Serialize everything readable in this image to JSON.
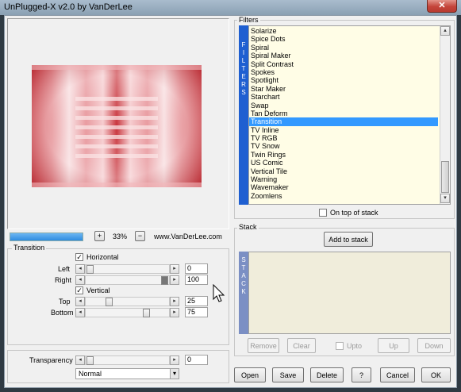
{
  "window": {
    "title": "UnPlugged-X v2.0 by VanDerLee",
    "close_glyph": "✕"
  },
  "zoom": {
    "plus": "+",
    "minus": "−",
    "value": "33%",
    "website": "www.VanDerLee.com",
    "progress": 1.0
  },
  "transition": {
    "group_label": "Transition",
    "horizontal_label": "Horizontal",
    "horizontal_checked": true,
    "vertical_label": "Vertical",
    "vertical_checked": true,
    "left": {
      "label": "Left",
      "value": "0"
    },
    "right": {
      "label": "Right",
      "value": "100"
    },
    "top": {
      "label": "Top",
      "value": "25"
    },
    "bottom": {
      "label": "Bottom",
      "value": "75"
    }
  },
  "transparency": {
    "label": "Transparency",
    "value": "0",
    "blend_mode": "Normal"
  },
  "filters": {
    "group_label": "Filters",
    "side_label": "FILTERS",
    "items": [
      "Solarize",
      "Spice Dots",
      "Spiral",
      "Spiral Maker",
      "Split Contrast",
      "Spokes",
      "Spotlight",
      "Star Maker",
      "Starchart",
      "Swap",
      "Tan Deform",
      "Transition",
      "TV Inline",
      "TV RGB",
      "TV Snow",
      "Twin Rings",
      "US Comic",
      "Vertical Tile",
      "Warning",
      "Wavemaker",
      "Zoomlens"
    ],
    "selected": "Transition",
    "on_top_label": "On top of stack"
  },
  "stack": {
    "group_label": "Stack",
    "side_label": "STACK",
    "add_label": "Add to stack",
    "remove_label": "Remove",
    "clear_label": "Clear",
    "upto_label": "Upto",
    "up_label": "Up",
    "down_label": "Down"
  },
  "footer": {
    "open": "Open",
    "save": "Save",
    "delete": "Delete",
    "help": "?",
    "cancel": "Cancel",
    "ok": "OK"
  },
  "icons": {
    "check": "✓",
    "left_arrow": "◂",
    "right_arrow": "▸",
    "up_arrow": "▴",
    "down_arrow": "▾"
  },
  "colors": {
    "accent": "#3399ff",
    "side_bar": "#1f5fd1",
    "stack_bar": "#7b8fc4",
    "preview_red": "#c8323a"
  }
}
